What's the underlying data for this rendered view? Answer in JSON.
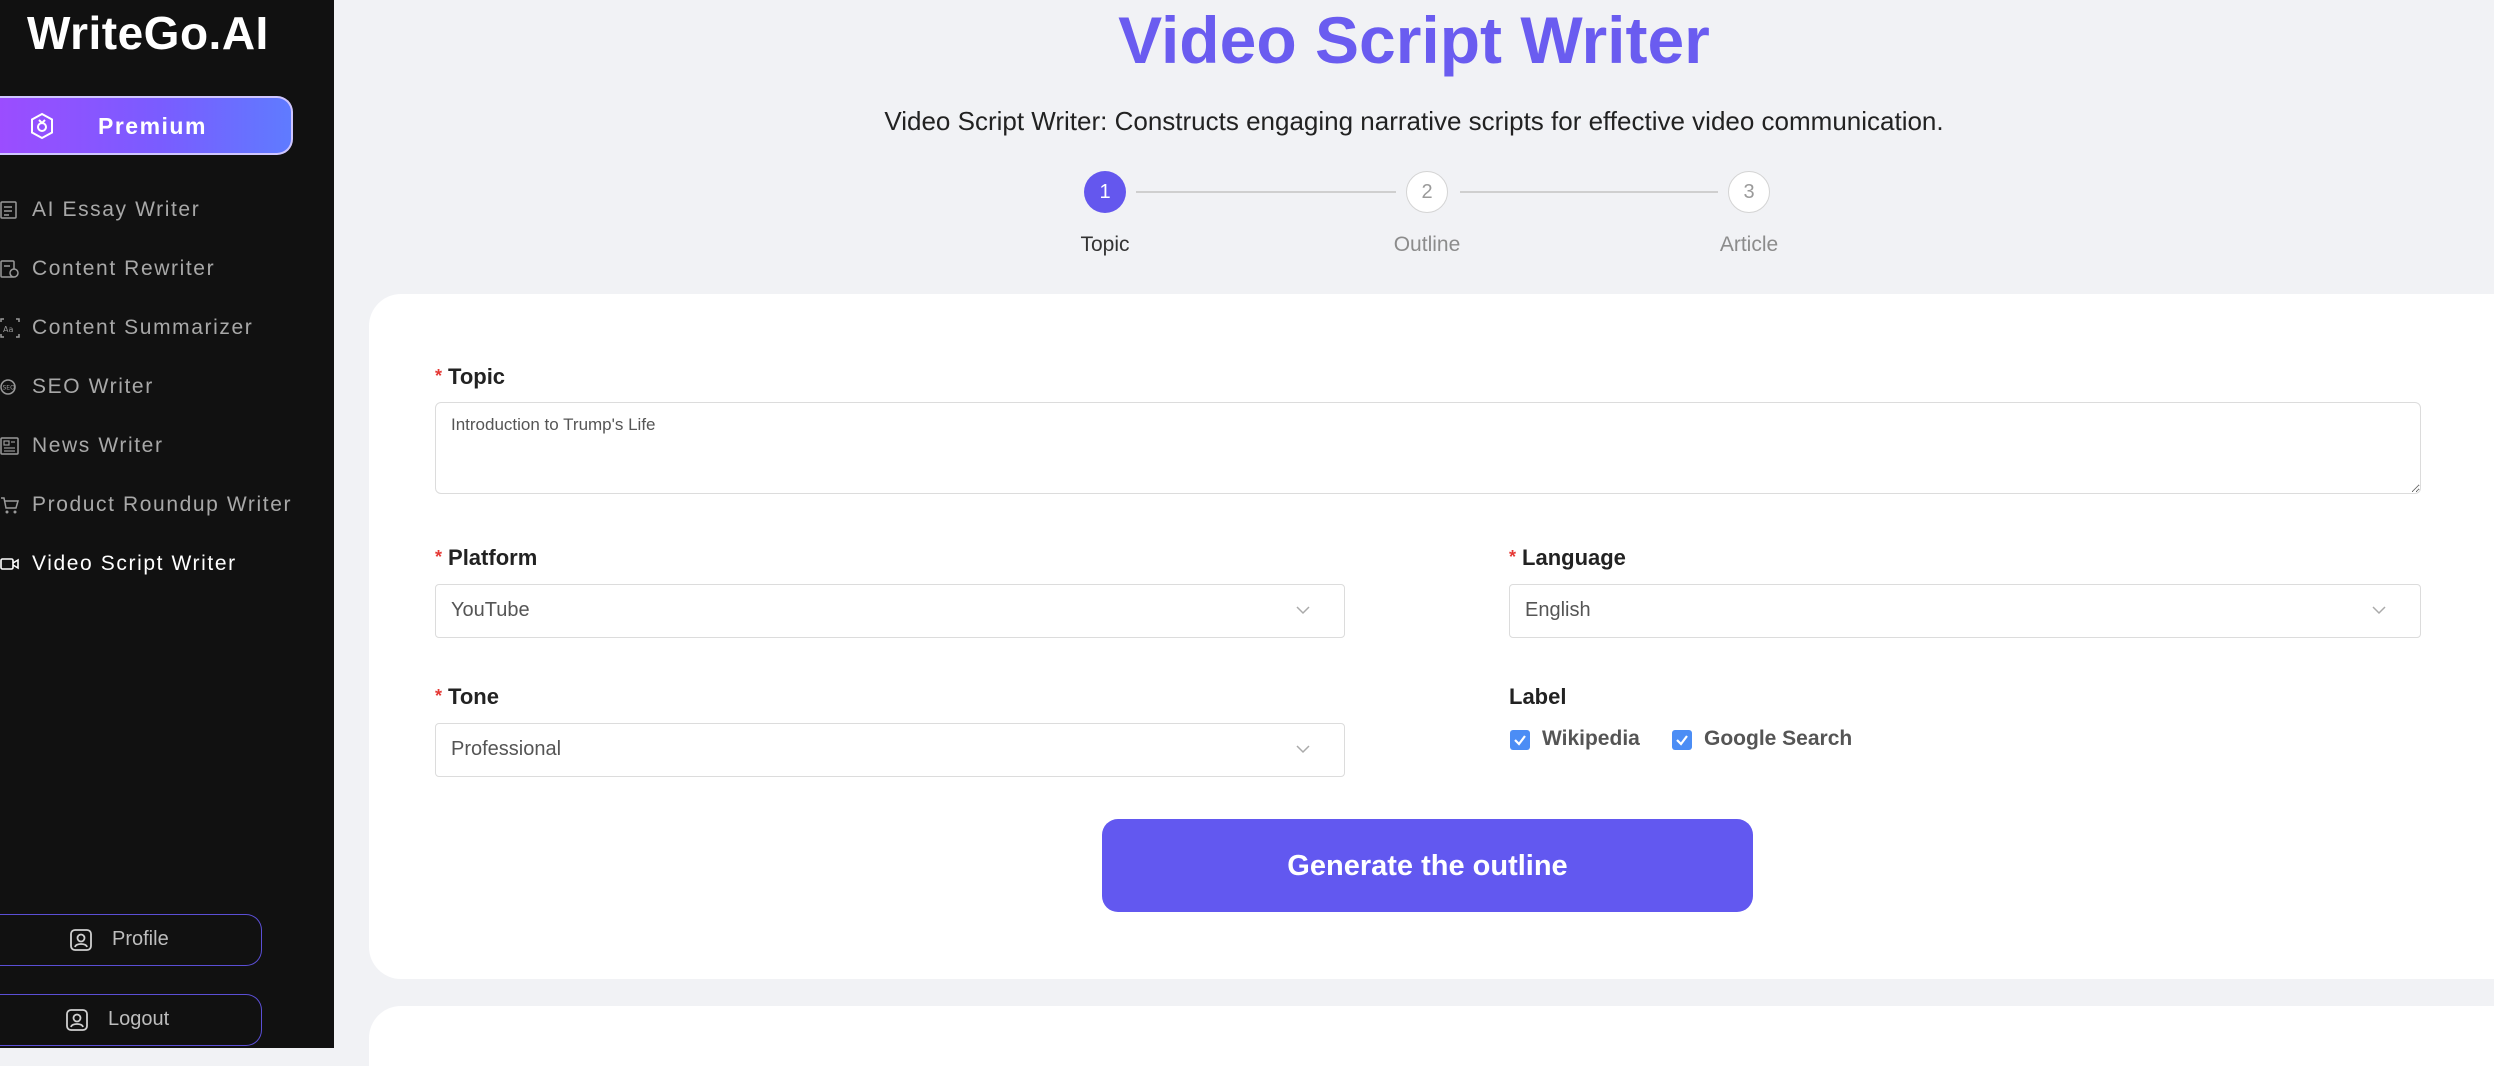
{
  "brand": "WriteGo.AI",
  "premium_label": "Premium",
  "nav": [
    {
      "label": "AI Essay Writer",
      "icon": "essay-icon"
    },
    {
      "label": "Content Rewriter",
      "icon": "rewrite-icon"
    },
    {
      "label": "Content Summarizer",
      "icon": "summarize-icon"
    },
    {
      "label": "SEO Writer",
      "icon": "seo-icon"
    },
    {
      "label": "News Writer",
      "icon": "news-icon"
    },
    {
      "label": "Product Roundup Writer",
      "icon": "cart-icon"
    },
    {
      "label": "Video Script Writer",
      "icon": "video-icon",
      "active": true
    }
  ],
  "profile_label": "Profile",
  "logout_label": "Logout",
  "page": {
    "title": "Video Script Writer",
    "subtitle": "Video Script Writer: Constructs engaging narrative scripts for effective video communication."
  },
  "steps": [
    {
      "number": "1",
      "label": "Topic",
      "active": true
    },
    {
      "number": "2",
      "label": "Outline",
      "active": false
    },
    {
      "number": "3",
      "label": "Article",
      "active": false
    }
  ],
  "form": {
    "topic_label": "Topic",
    "topic_value": "Introduction to Trump's Life",
    "platform_label": "Platform",
    "platform_value": "YouTube",
    "language_label": "Language",
    "language_value": "English",
    "tone_label": "Tone",
    "tone_value": "Professional",
    "label_heading": "Label",
    "checkboxes": [
      {
        "label": "Wikipedia",
        "checked": true
      },
      {
        "label": "Google Search",
        "checked": true
      }
    ],
    "generate_label": "Generate the outline"
  },
  "colors": {
    "accent": "#6457ee",
    "sidebar_bg": "#111111",
    "required": "#e53935",
    "checkbox": "#4b8df5"
  }
}
